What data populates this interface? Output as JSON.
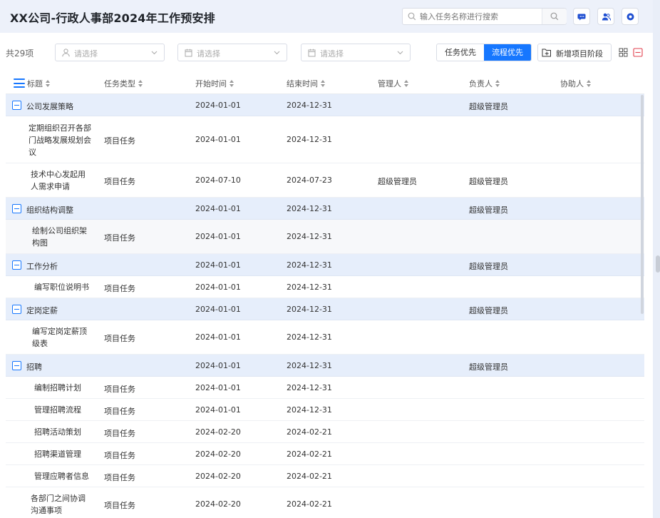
{
  "header": {
    "title": "XX公司-行政人事部2024年工作预安排",
    "search_placeholder": "输入任务名称进行搜索"
  },
  "toolbar": {
    "count": "共29项",
    "filters": [
      {
        "placeholder": "请选择",
        "icon": "user-icon"
      },
      {
        "placeholder": "请选择",
        "icon": "calendar-icon"
      },
      {
        "placeholder": "请选择",
        "icon": "calendar-icon"
      }
    ],
    "mode_task": "任务优先",
    "mode_flow": "流程优先",
    "add_stage": "新增项目阶段"
  },
  "table": {
    "columns": [
      "标题",
      "任务类型",
      "开始时间",
      "结束时间",
      "管理人",
      "负责人",
      "协助人"
    ],
    "rows": [
      {
        "group": true,
        "title": "公司发展策略",
        "type": "",
        "start": "2024-01-01",
        "end": "2024-12-31",
        "manager": "",
        "owner": "超级管理员",
        "assist": ""
      },
      {
        "group": false,
        "title": "定期组织召开各部门战略发展规划会议",
        "type": "项目任务",
        "start": "2024-01-01",
        "end": "2024-12-31",
        "manager": "",
        "owner": "",
        "assist": ""
      },
      {
        "group": false,
        "title": "技术中心发起用人需求申请",
        "type": "项目任务",
        "start": "2024-07-10",
        "end": "2024-07-23",
        "manager": "超级管理员",
        "owner": "超级管理员",
        "assist": ""
      },
      {
        "group": true,
        "title": "组织结构调整",
        "type": "",
        "start": "2024-01-01",
        "end": "2024-12-31",
        "manager": "",
        "owner": "超级管理员",
        "assist": ""
      },
      {
        "group": false,
        "title": "绘制公司组织架构图",
        "type": "项目任务",
        "start": "2024-01-01",
        "end": "2024-12-31",
        "manager": "",
        "owner": "",
        "assist": ""
      },
      {
        "group": true,
        "title": "工作分析",
        "type": "",
        "start": "2024-01-01",
        "end": "2024-12-31",
        "manager": "",
        "owner": "超级管理员",
        "assist": ""
      },
      {
        "group": false,
        "title": "编写职位说明书",
        "type": "项目任务",
        "start": "2024-01-01",
        "end": "2024-12-31",
        "manager": "",
        "owner": "",
        "assist": ""
      },
      {
        "group": true,
        "title": "定岗定薪",
        "type": "",
        "start": "2024-01-01",
        "end": "2024-12-31",
        "manager": "",
        "owner": "超级管理员",
        "assist": ""
      },
      {
        "group": false,
        "title": "编写定岗定薪顶级表",
        "type": "项目任务",
        "start": "2024-01-01",
        "end": "2024-12-31",
        "manager": "",
        "owner": "",
        "assist": ""
      },
      {
        "group": true,
        "title": "招聘",
        "type": "",
        "start": "2024-01-01",
        "end": "2024-12-31",
        "manager": "",
        "owner": "超级管理员",
        "assist": ""
      },
      {
        "group": false,
        "title": "编制招聘计划",
        "type": "项目任务",
        "start": "2024-01-01",
        "end": "2024-12-31",
        "manager": "",
        "owner": "",
        "assist": ""
      },
      {
        "group": false,
        "title": "管理招聘流程",
        "type": "项目任务",
        "start": "2024-01-01",
        "end": "2024-12-31",
        "manager": "",
        "owner": "",
        "assist": ""
      },
      {
        "group": false,
        "title": "招聘活动策划",
        "type": "项目任务",
        "start": "2024-02-20",
        "end": "2024-02-21",
        "manager": "",
        "owner": "",
        "assist": ""
      },
      {
        "group": false,
        "title": "招聘渠道管理",
        "type": "项目任务",
        "start": "2024-02-20",
        "end": "2024-02-21",
        "manager": "",
        "owner": "",
        "assist": ""
      },
      {
        "group": false,
        "title": "管理应聘者信息",
        "type": "项目任务",
        "start": "2024-02-20",
        "end": "2024-02-21",
        "manager": "",
        "owner": "",
        "assist": ""
      },
      {
        "group": false,
        "title": "各部门之间协调沟通事项",
        "type": "项目任务",
        "start": "2024-02-20",
        "end": "2024-02-21",
        "manager": "",
        "owner": "",
        "assist": ""
      }
    ]
  },
  "colors": {
    "accent": "#1677ff",
    "group_bg": "#e6eefb",
    "header_bg": "#edf1fa"
  }
}
